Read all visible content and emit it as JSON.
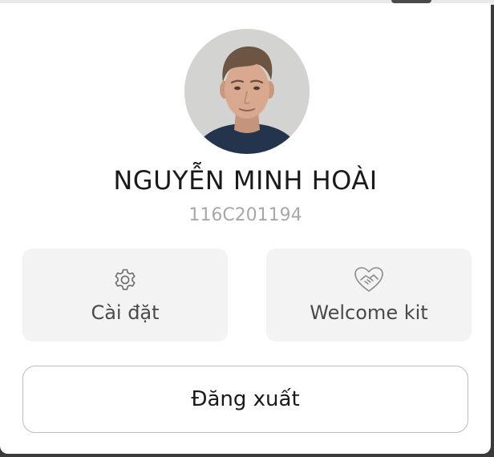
{
  "profile": {
    "name": "NGUYỄN MINH HOÀI",
    "code": "116C201194"
  },
  "actions": [
    {
      "label": "Cài đặt",
      "icon": "gear-icon"
    },
    {
      "label": "Welcome kit",
      "icon": "handshake-heart-icon"
    }
  ],
  "logout": {
    "label": "Đăng xuất"
  }
}
